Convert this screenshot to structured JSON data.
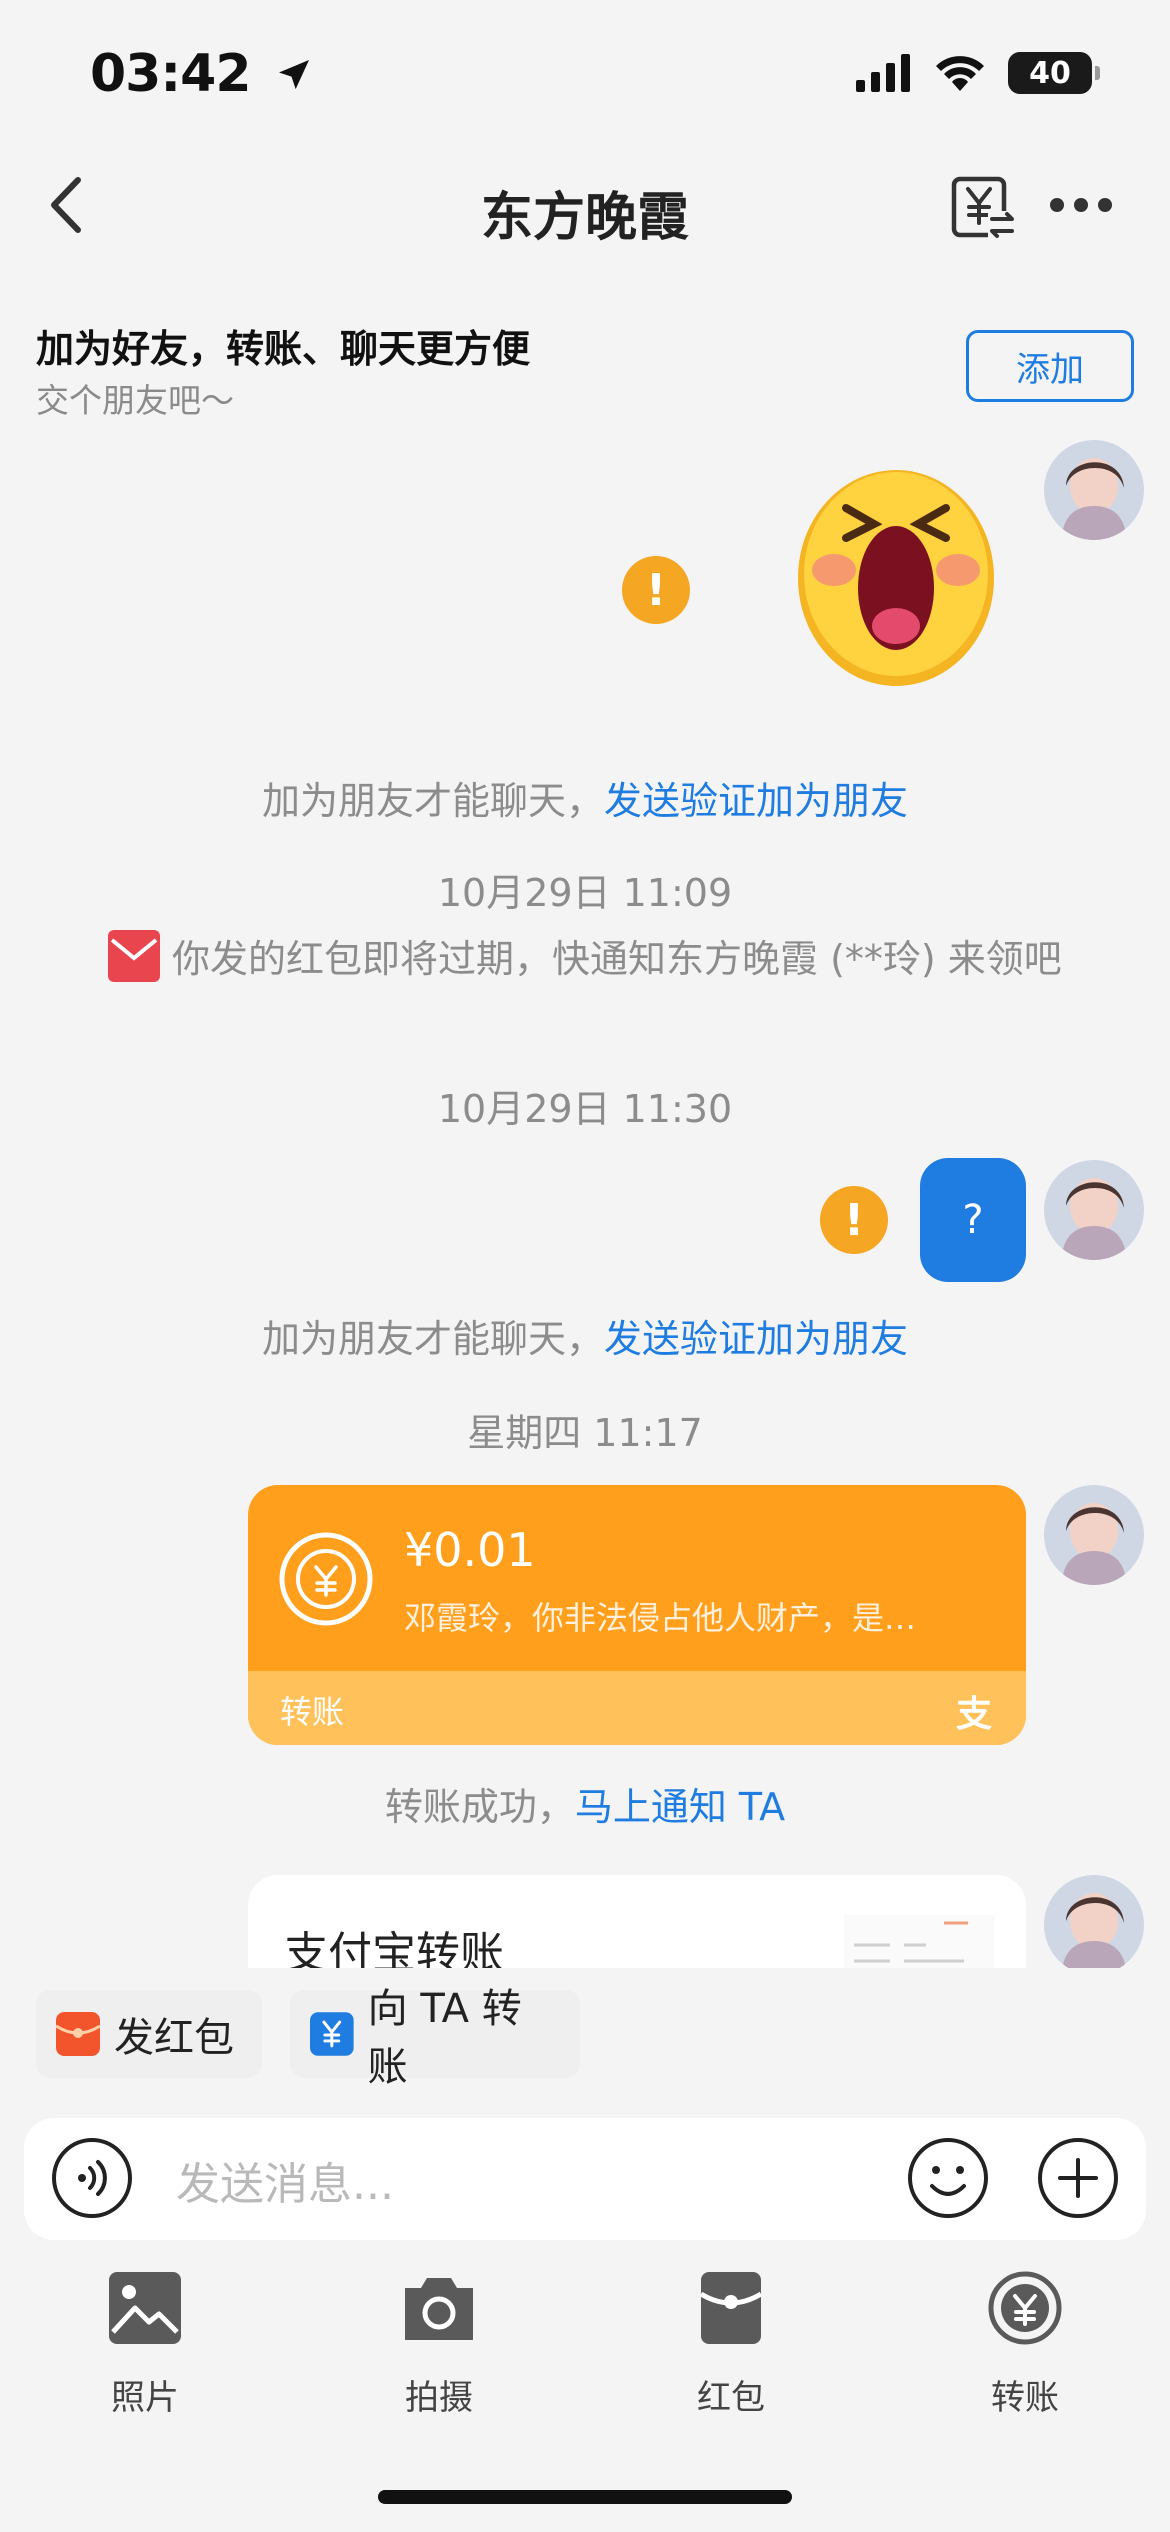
{
  "status_bar": {
    "time": "03:42",
    "battery": "40"
  },
  "nav": {
    "title": "东方晚霞",
    "back_icon": "chevron-left-icon",
    "transfer_icon": "yuan-transfer-icon",
    "more_icon": "more-dots-icon"
  },
  "friend_banner": {
    "title": "加为好友，转账、聊天更方便",
    "subtitle": "交个朋友吧～",
    "add_label": "添加"
  },
  "messages": {
    "system_notice_1": {
      "text": "加为朋友才能聊天，",
      "link": "发送验证加为朋友"
    },
    "timestamp_1": "10月29日 11:09",
    "redpacket_notice": "你发的红包即将过期，快通知东方晚霞 (**玲) 来领吧",
    "timestamp_2": "10月29日 11:30",
    "question_bubble": "?",
    "warning_mark": "!",
    "system_notice_2": {
      "text": "加为朋友才能聊天，",
      "link": "发送验证加为朋友"
    },
    "timestamp_3": "星期四 11:17",
    "transfer_card": {
      "amount": "¥0.01",
      "memo": "邓霞玲，你非法侵占他人财产，是…",
      "label": "转账",
      "brand": "支"
    },
    "transfer_success": {
      "text": "转账成功，",
      "link": "马上通知 TA"
    },
    "alipay_card": {
      "title": "支付宝转账"
    }
  },
  "quick_actions": {
    "red_packet": "发红包",
    "transfer": "向 TA 转账"
  },
  "input": {
    "placeholder": "发送消息..."
  },
  "toolbar": {
    "photo": "照片",
    "camera": "拍摄",
    "red_packet": "红包",
    "transfer": "转账"
  },
  "colors": {
    "accent_blue": "#1f7ce0",
    "transfer_orange": "#ff9f1c",
    "warning": "#f5a623",
    "red_packet": "#e8454f"
  }
}
